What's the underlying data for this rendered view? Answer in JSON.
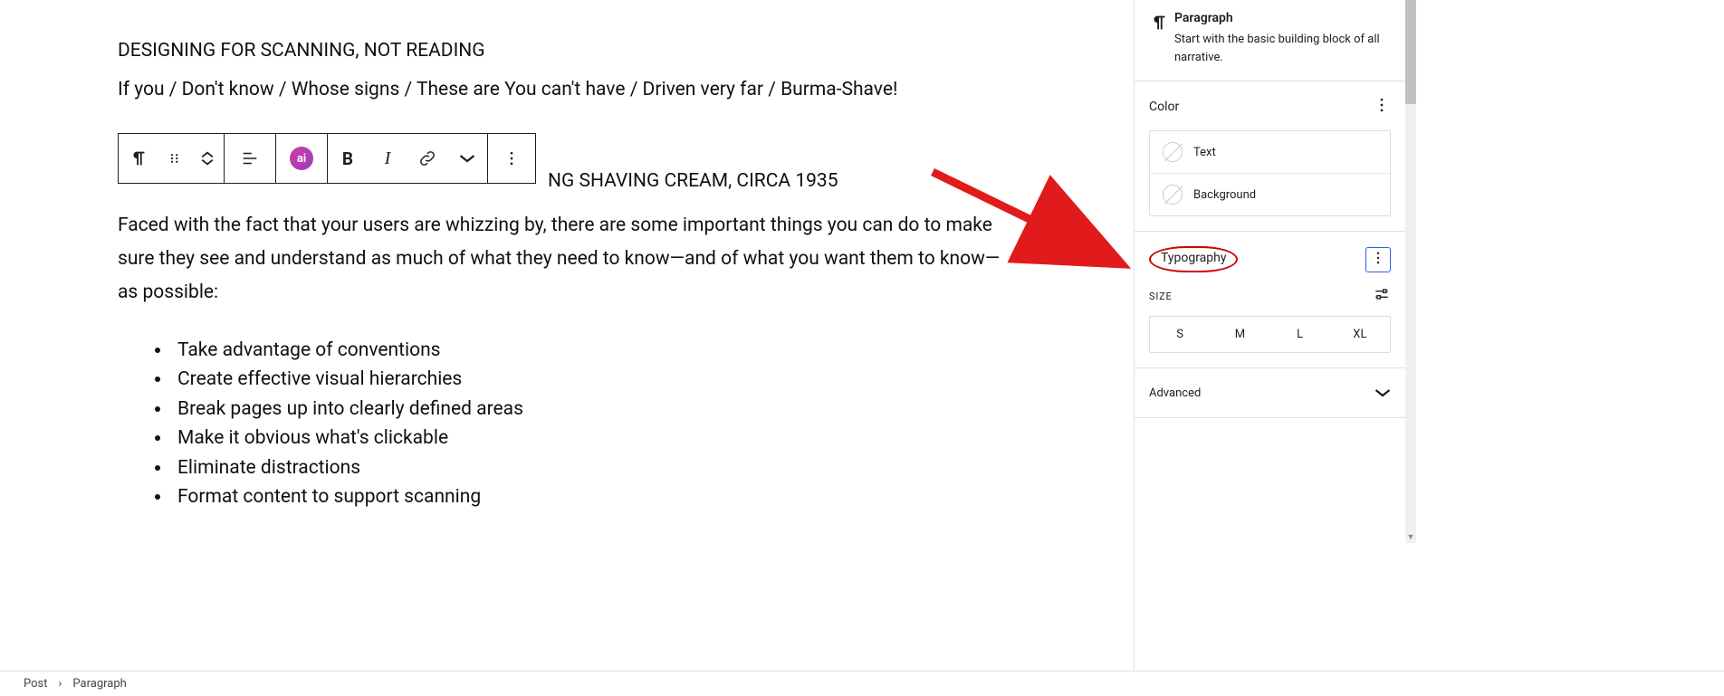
{
  "content": {
    "heading": "DESIGNING FOR SCANNING, NOT READING",
    "verse": "If you / Don't know / Whose signs / These are You can't have / Driven very far / Burma-Shave!",
    "caption_tail": "NG SHAVING CREAM, CIRCA 1935",
    "body": "Faced with the fact that your users are whizzing by, there are some important things you can do to make sure they see and understand as much of what they need to know—and of what you want them to know—as possible:",
    "bullets": [
      "Take advantage of conventions",
      "Create effective visual hierarchies",
      "Break pages up into clearly defined areas",
      "Make it obvious what's clickable",
      "Eliminate distractions",
      "Format content to support scanning"
    ]
  },
  "toolbar": {
    "ai_label": "ai",
    "bold": "B",
    "italic": "I"
  },
  "sidebar": {
    "block": {
      "title": "Paragraph",
      "desc": "Start with the basic building block of all narrative."
    },
    "color": {
      "title": "Color",
      "text": "Text",
      "background": "Background"
    },
    "typography": {
      "title": "Typography",
      "size_label": "SIZE",
      "sizes": [
        "S",
        "M",
        "L",
        "XL"
      ]
    },
    "advanced": "Advanced"
  },
  "breadcrumb": {
    "root": "Post",
    "current": "Paragraph",
    "sep": "›"
  },
  "annotations": {
    "arrow_color": "#e11b1b",
    "circle_color": "#d40000",
    "highlight_color": "#2563eb"
  }
}
